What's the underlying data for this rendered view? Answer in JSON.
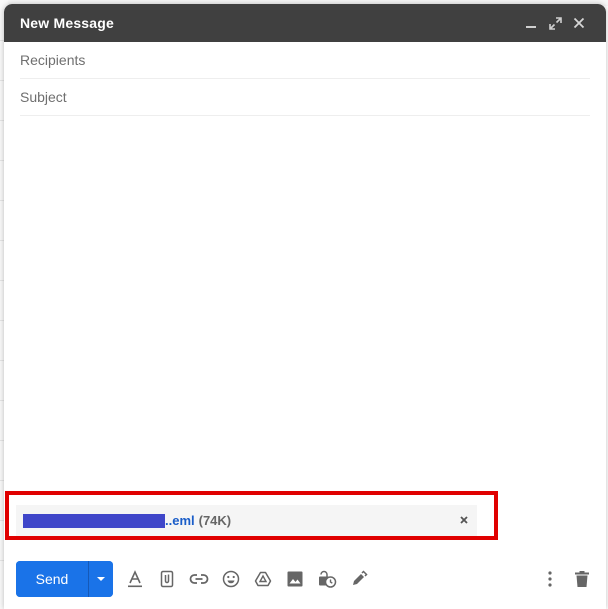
{
  "window": {
    "title": "New Message",
    "controls": {
      "minimize": "minimize-icon",
      "fullscreen": "expand-icon",
      "close": "close-icon"
    }
  },
  "fields": {
    "recipients": {
      "placeholder": "Recipients",
      "value": ""
    },
    "subject": {
      "placeholder": "Subject",
      "value": ""
    }
  },
  "body": {
    "value": ""
  },
  "attachment": {
    "name_redacted": true,
    "name_suffix": "..eml",
    "size": "(74K)",
    "remove_icon": "close-icon",
    "highlight_color": "#e00000"
  },
  "toolbar": {
    "send_label": "Send",
    "more_send_options_icon": "caret-down-icon",
    "tools": [
      {
        "name": "formatting-options",
        "icon": "text-format-icon"
      },
      {
        "name": "attach-files",
        "icon": "paperclip-icon"
      },
      {
        "name": "insert-link",
        "icon": "link-icon"
      },
      {
        "name": "insert-emoji",
        "icon": "emoji-icon"
      },
      {
        "name": "insert-drive",
        "icon": "drive-icon"
      },
      {
        "name": "insert-photo",
        "icon": "photo-icon"
      },
      {
        "name": "confidential-mode",
        "icon": "lock-clock-icon"
      },
      {
        "name": "insert-signature",
        "icon": "pen-icon"
      }
    ],
    "more_options_icon": "more-vert-icon",
    "discard_icon": "trash-icon"
  },
  "colors": {
    "titlebar": "#404040",
    "send": "#1a73e8",
    "link": "#1a5dc8",
    "redaction": "#3f46c9"
  }
}
